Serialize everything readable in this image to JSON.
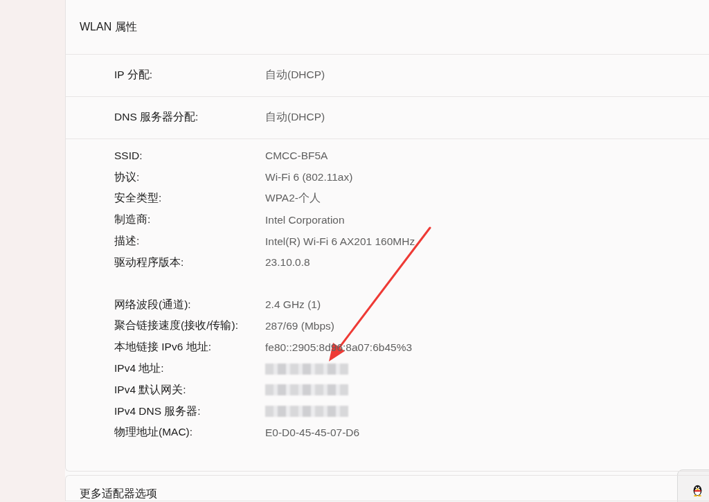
{
  "section": {
    "title": "WLAN 属性",
    "groups": [
      {
        "blocks": [
          [
            {
              "label": "IP 分配:",
              "value": "自动(DHCP)"
            }
          ]
        ]
      },
      {
        "blocks": [
          [
            {
              "label": "DNS 服务器分配:",
              "value": "自动(DHCP)"
            }
          ]
        ]
      },
      {
        "blocks": [
          [
            {
              "label": "SSID:",
              "value": "CMCC-BF5A"
            },
            {
              "label": "协议:",
              "value": "Wi-Fi 6 (802.11ax)"
            },
            {
              "label": "安全类型:",
              "value": "WPA2-个人"
            },
            {
              "label": "制造商:",
              "value": "Intel Corporation"
            },
            {
              "label": "描述:",
              "value": "Intel(R) Wi-Fi 6 AX201 160MHz"
            },
            {
              "label": "驱动程序版本:",
              "value": "23.10.0.8"
            }
          ],
          [
            {
              "label": "网络波段(通道):",
              "value": "2.4 GHz (1)"
            },
            {
              "label": "聚合链接速度(接收/传输):",
              "value": "287/69 (Mbps)"
            },
            {
              "label": "本地链接 IPv6 地址:",
              "value": "fe80::2905:8d96:8a07:6b45%3"
            },
            {
              "label": "IPv4 地址:",
              "redacted": true
            },
            {
              "label": "IPv4 默认网关:",
              "redacted": true
            },
            {
              "label": "IPv4 DNS 服务器:",
              "redacted": true
            },
            {
              "label": "物理地址(MAC):",
              "value": "E0-D0-45-45-07-D6"
            }
          ]
        ]
      }
    ]
  },
  "next_section": {
    "title": "更多适配器选项"
  },
  "annotation": {
    "kind": "arrow",
    "color": "#ee3a35"
  },
  "notification": {
    "kind": "qq"
  }
}
